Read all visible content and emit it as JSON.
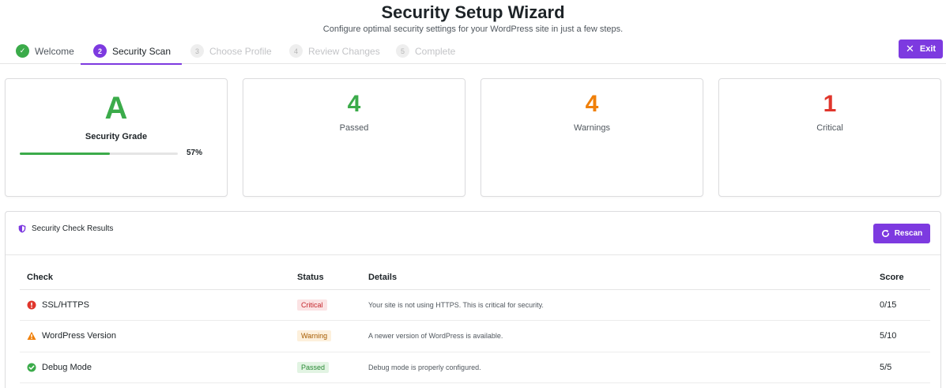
{
  "header": {
    "title": "Security Setup Wizard",
    "subtitle": "Configure optimal security settings for your WordPress site in just a few steps."
  },
  "steps": [
    {
      "num": "✓",
      "label": "Welcome",
      "state": "done"
    },
    {
      "num": "2",
      "label": "Security Scan",
      "state": "active"
    },
    {
      "num": "3",
      "label": "Choose Profile",
      "state": "pending"
    },
    {
      "num": "4",
      "label": "Review Changes",
      "state": "pending"
    },
    {
      "num": "5",
      "label": "Complete",
      "state": "pending"
    }
  ],
  "exit_button": {
    "icon": "close-icon",
    "label": "Exit"
  },
  "grade_card": {
    "grade": "A",
    "label": "Security Grade",
    "progress": 57,
    "progress_text": "57%",
    "color": "#3bab4a"
  },
  "stats": [
    {
      "value": "4",
      "label": "Passed",
      "color": "#3bab4a"
    },
    {
      "value": "4",
      "label": "Warnings",
      "color": "#f0800a"
    },
    {
      "value": "1",
      "label": "Critical",
      "color": "#e0362c"
    }
  ],
  "results": {
    "icon": "shield-icon",
    "title": "Security Check Results",
    "rescan_label": "Rescan",
    "columns": [
      "Check",
      "Status",
      "Details",
      "Score"
    ],
    "rows": [
      {
        "icon": "error-icon",
        "check": "SSL/HTTPS",
        "status": "Critical",
        "status_type": "critical",
        "details": "Your site is not using HTTPS. This is critical for security.",
        "score": "0/15"
      },
      {
        "icon": "warning-icon",
        "check": "WordPress Version",
        "status": "Warning",
        "status_type": "warning",
        "details": "A newer version of WordPress is available.",
        "score": "5/10"
      },
      {
        "icon": "check-circle-icon",
        "check": "Debug Mode",
        "status": "Passed",
        "status_type": "passed",
        "details": "Debug mode is properly configured.",
        "score": "5/5"
      }
    ]
  },
  "colors": {
    "accent": "#7d3ae0",
    "success": "#3bab4a",
    "warning": "#f0800a",
    "critical": "#e0362c"
  }
}
